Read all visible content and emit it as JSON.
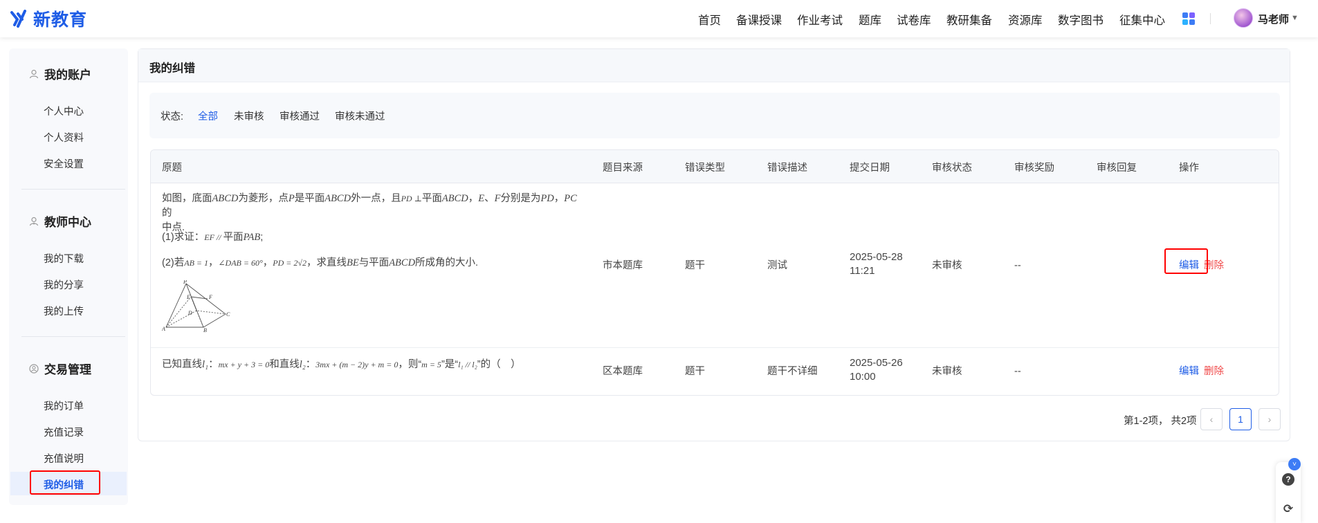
{
  "header": {
    "logo_text": "新教育",
    "nav": [
      "首页",
      "备课授课",
      "作业考试",
      "题库",
      "试卷库",
      "教研集备",
      "资源库",
      "数字图书",
      "征集中心"
    ],
    "user_name": "马老师",
    "brand_color": "#1f5de6"
  },
  "sidebar": {
    "sections": [
      {
        "title": "我的账户",
        "items": [
          "个人中心",
          "个人资料",
          "安全设置"
        ]
      },
      {
        "title": "教师中心",
        "items": [
          "我的下载",
          "我的分享",
          "我的上传"
        ]
      },
      {
        "title": "交易管理",
        "items": [
          "我的订单",
          "充值记录",
          "充值说明",
          "我的纠错"
        ]
      }
    ],
    "active_item": "我的纠错"
  },
  "main": {
    "title": "我的纠错",
    "filter": {
      "label": "状态:",
      "options": [
        "全部",
        "未审核",
        "审核通过",
        "审核未通过"
      ],
      "selected": "全部"
    },
    "table": {
      "columns": [
        "原题",
        "题目来源",
        "错误类型",
        "错误描述",
        "提交日期",
        "审核状态",
        "审核奖励",
        "审核回复",
        "操作"
      ],
      "rows": [
        {
          "question": {
            "line1_a": "如图，底面",
            "line1_b": "ABCD",
            "line1_c": "为菱形，点",
            "line1_d": "P",
            "line1_e": "是平面",
            "line1_f": "ABCD",
            "line1_g": "外一点，且",
            "line1_h": "PD ⊥",
            "line1_i": "平面",
            "line1_j": "ABCD",
            "line1_k": "，",
            "line1_l": "E",
            "line1_m": "、",
            "line1_n": "F",
            "line1_o": "分别是为",
            "line1_p": "PD",
            "line1_q": "，",
            "line1_r": "PC",
            "line1_s": "的",
            "line2": "中点.",
            "part1_a": "(1)求证：",
            "part1_b": "EF // ",
            "part1_c": "平面",
            "part1_d": "PAB",
            "part1_e": ";",
            "part2_a": "(2)若",
            "part2_b": "AB = 1",
            "part2_c": "，",
            "part2_d": "∠DAB = 60°",
            "part2_e": "，",
            "part2_f": "PD = 2√2",
            "part2_g": "，求直线",
            "part2_h": "BE",
            "part2_i": "与平面",
            "part2_j": "ABCD",
            "part2_k": "所成角的大小.",
            "fig_labels": [
              "P",
              "E",
              "F",
              "D",
              "A",
              "B",
              "C"
            ]
          },
          "source": "市本题库",
          "error_type": "题干",
          "description": "测试",
          "date": "2025-05-28",
          "time": "11:21",
          "status": "未审核",
          "reward": "--",
          "reply": "",
          "edit": "编辑",
          "delete": "删除"
        },
        {
          "question": {
            "a": "已知直线",
            "b": "l₁",
            "c": "：",
            "d": "mx + y + 3 = 0",
            "e": "和直线",
            "f": "l₂",
            "g": "：",
            "h": "3mx + (m − 2)y + m = 0",
            "i": "，则“",
            "j": "m = 5",
            "k": "”是“",
            "l": "l₁ // l₂",
            "m": "”的（　）"
          },
          "source": "区本题库",
          "error_type": "题干",
          "description": "题干不详细",
          "date": "2025-05-26",
          "time": "10:00",
          "status": "未审核",
          "reward": "--",
          "reply": "",
          "edit": "编辑",
          "delete": "删除"
        }
      ]
    },
    "pagination": {
      "summary": "第1-2项，  共2项",
      "prev": "‹",
      "current": "1",
      "next": "›"
    }
  },
  "float_tools": {
    "badge": "˅",
    "help": "?",
    "refresh": "⟳"
  }
}
